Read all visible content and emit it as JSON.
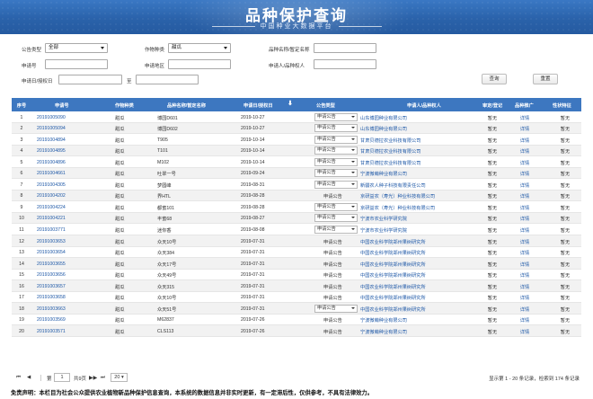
{
  "banner": {
    "title": "品种保护查询",
    "subtitle": "中国种业大数据平台"
  },
  "filters": {
    "announce_type_label": "公告类型",
    "announce_type_value": "全部",
    "crop_label": "作物种类",
    "crop_value": "甜瓜",
    "variety_name_label": "品种名称/暂定名称",
    "variety_name_value": "",
    "app_no_label": "申请号",
    "app_no_value": "",
    "region_label": "申请地区",
    "region_value": "",
    "applicant_label": "申请人/品种权人",
    "applicant_value": "",
    "app_date_label": "申请日/授权日",
    "date_from": "",
    "to_label": "至",
    "date_to": "",
    "query_button": "查询",
    "reset_button": "重置"
  },
  "table": {
    "headers": {
      "idx": "序号",
      "app_no": "申请号",
      "crop": "作物种类",
      "name": "品种名称/暂定名称",
      "date": "申请日/授权日",
      "type": "公告类型",
      "applicant": "申请人/品种权人",
      "status": "审定/登记",
      "promo": "品种推广",
      "special": "性状特征"
    },
    "rows": [
      {
        "idx": "1",
        "app_no": "20191005090",
        "crop": "甜瓜",
        "name": "博园D601",
        "date": "2019-10-27",
        "type": "申请公告",
        "select": true,
        "applicant": "山东博园种业有限公司",
        "status": "暂无",
        "detail": "详情",
        "special": "暂无"
      },
      {
        "idx": "2",
        "app_no": "20191005094",
        "crop": "甜瓜",
        "name": "博园D602",
        "date": "2019-10-27",
        "type": "申请公告",
        "select": true,
        "applicant": "山东博园种业有限公司",
        "status": "暂无",
        "detail": "详情",
        "special": "暂无"
      },
      {
        "idx": "3",
        "app_no": "20191004894",
        "crop": "甜瓜",
        "name": "T905",
        "date": "2019-10-14",
        "type": "申请公告",
        "select": true,
        "applicant": "甘肃贝德拉农业科技有限公司",
        "status": "暂无",
        "detail": "详情",
        "special": "暂无"
      },
      {
        "idx": "4",
        "app_no": "20191004895",
        "crop": "甜瓜",
        "name": "T101",
        "date": "2019-10-14",
        "type": "申请公告",
        "select": true,
        "applicant": "甘肃贝德拉农业科技有限公司",
        "status": "暂无",
        "detail": "详情",
        "special": "暂无"
      },
      {
        "idx": "5",
        "app_no": "20191004896",
        "crop": "甜瓜",
        "name": "M102",
        "date": "2019-10-14",
        "type": "申请公告",
        "select": true,
        "applicant": "甘肃贝德拉农业科技有限公司",
        "status": "暂无",
        "detail": "详情",
        "special": "暂无"
      },
      {
        "idx": "6",
        "app_no": "20191004661",
        "crop": "甜瓜",
        "name": "吐翠一号",
        "date": "2019-09-24",
        "type": "申请公告",
        "select": true,
        "applicant": "宁波微萌种业有限公司",
        "status": "暂无",
        "detail": "详情",
        "special": "暂无"
      },
      {
        "idx": "7",
        "app_no": "20191004305",
        "crop": "甜瓜",
        "name": "梦圆峰",
        "date": "2019-08-31",
        "type": "申请公告",
        "select": true,
        "applicant": "新疆农人种子科技有限责任公司",
        "status": "暂无",
        "detail": "详情",
        "special": "暂无"
      },
      {
        "idx": "8",
        "app_no": "20191004202",
        "crop": "甜瓜",
        "name": "界HTL",
        "date": "2019-08-28",
        "type": "申请公告",
        "select": false,
        "applicant": "京研益农（寿光）种业科技有限公司",
        "status": "暂无",
        "detail": "详情",
        "special": "暂无"
      },
      {
        "idx": "9",
        "app_no": "20191004224",
        "crop": "甜瓜",
        "name": "都蜜101",
        "date": "2019-08-28",
        "type": "申请公告",
        "select": true,
        "applicant": "京研益农（寿光）种业科技有限公司",
        "status": "暂无",
        "detail": "详情",
        "special": "暂无"
      },
      {
        "idx": "10",
        "app_no": "20191004221",
        "crop": "甜瓜",
        "name": "丰蜜68",
        "date": "2019-08-27",
        "type": "申请公告",
        "select": true,
        "applicant": "宁波市农业科学研究院",
        "status": "暂无",
        "detail": "详情",
        "special": "暂无"
      },
      {
        "idx": "11",
        "app_no": "20191003771",
        "crop": "甜瓜",
        "name": "迷你香",
        "date": "2019-08-08",
        "type": "申请公告",
        "select": true,
        "applicant": "宁波市农业科学研究院",
        "status": "暂无",
        "detail": "详情",
        "special": "暂无"
      },
      {
        "idx": "12",
        "app_no": "20191003653",
        "crop": "甜瓜",
        "name": "众天10号",
        "date": "2019-07-31",
        "type": "申请公告",
        "select": false,
        "applicant": "中国农业科学院郑州果树研究所",
        "status": "暂无",
        "detail": "详情",
        "special": "暂无"
      },
      {
        "idx": "13",
        "app_no": "20191003654",
        "crop": "甜瓜",
        "name": "众天384",
        "date": "2019-07-31",
        "type": "申请公告",
        "select": false,
        "applicant": "中国农业科学院郑州果树研究所",
        "status": "暂无",
        "detail": "详情",
        "special": "暂无"
      },
      {
        "idx": "14",
        "app_no": "20191003655",
        "crop": "甜瓜",
        "name": "众天17号",
        "date": "2019-07-31",
        "type": "申请公告",
        "select": false,
        "applicant": "中国农业科学院郑州果树研究所",
        "status": "暂无",
        "detail": "详情",
        "special": "暂无"
      },
      {
        "idx": "15",
        "app_no": "20191003656",
        "crop": "甜瓜",
        "name": "众天49号",
        "date": "2019-07-31",
        "type": "申请公告",
        "select": false,
        "applicant": "中国农业科学院郑州果树研究所",
        "status": "暂无",
        "detail": "详情",
        "special": "暂无"
      },
      {
        "idx": "16",
        "app_no": "20191003657",
        "crop": "甜瓜",
        "name": "众天315",
        "date": "2019-07-31",
        "type": "申请公告",
        "select": false,
        "applicant": "中国农业科学院郑州果树研究所",
        "status": "暂无",
        "detail": "详情",
        "special": "暂无"
      },
      {
        "idx": "17",
        "app_no": "20191003658",
        "crop": "甜瓜",
        "name": "众天10号",
        "date": "2019-07-31",
        "type": "申请公告",
        "select": false,
        "applicant": "中国农业科学院郑州果树研究所",
        "status": "暂无",
        "detail": "详情",
        "special": "暂无"
      },
      {
        "idx": "18",
        "app_no": "20191003663",
        "crop": "甜瓜",
        "name": "众天51号",
        "date": "2019-07-31",
        "type": "申请公告",
        "select": true,
        "applicant": "中国农业科学院郑州果树研究所",
        "status": "暂无",
        "detail": "详情",
        "special": "暂无"
      },
      {
        "idx": "19",
        "app_no": "20191003569",
        "crop": "甜瓜",
        "name": "M62837",
        "date": "2019-07-26",
        "type": "申请公告",
        "select": false,
        "applicant": "宁波微萌种业有限公司",
        "status": "暂无",
        "detail": "详情",
        "special": "暂无"
      },
      {
        "idx": "20",
        "app_no": "20191003571",
        "crop": "甜瓜",
        "name": "CLS113",
        "date": "2019-07-26",
        "type": "申请公告",
        "select": false,
        "applicant": "宁波微萌种业有限公司",
        "status": "暂无",
        "detail": "详情",
        "special": "暂无"
      }
    ]
  },
  "pager": {
    "page_value": "1",
    "of_pages": "共9页",
    "page_size": "20",
    "range_text": "显示第 1 - 20 条记录",
    "total_text": "检索到 174 条记录"
  },
  "disclaimer": "免责声明：本栏目为社会公众提供农业植物新品种保护信息查询，本系统的数据信息并非实时更新，有一定滞后性，仅供参考，不具有法律效力。",
  "colors": {
    "banner": "#2a62aa",
    "header": "#3d77c0",
    "link": "#1b56a6"
  }
}
